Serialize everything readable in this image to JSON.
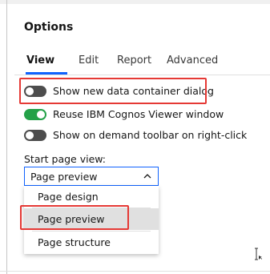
{
  "dialog": {
    "title": "Options"
  },
  "tabs": [
    {
      "label": "View",
      "active": true
    },
    {
      "label": "Edit",
      "active": false
    },
    {
      "label": "Report",
      "active": false
    },
    {
      "label": "Advanced",
      "active": false
    }
  ],
  "options": [
    {
      "label": "Show new data container dialog",
      "enabled": false,
      "highlighted": true
    },
    {
      "label": "Reuse IBM Cognos Viewer window",
      "enabled": true,
      "highlighted": false
    },
    {
      "label": "Show on demand toolbar on right-click",
      "enabled": false,
      "highlighted": false
    }
  ],
  "start_page_view": {
    "label": "Start page view:",
    "selected": "Page preview",
    "options": [
      "Page design",
      "Page preview",
      "Page structure"
    ],
    "highlighted_option": "Page preview"
  },
  "colors": {
    "accent": "#0f62fe",
    "toggle_on": "#24a148",
    "toggle_off": "#4d4d4d",
    "highlight": "#e53935",
    "selected_bg": "#e0e0e0"
  },
  "icons": {
    "chevron": "chevron-up-icon",
    "cursor": "text-cursor-icon"
  }
}
